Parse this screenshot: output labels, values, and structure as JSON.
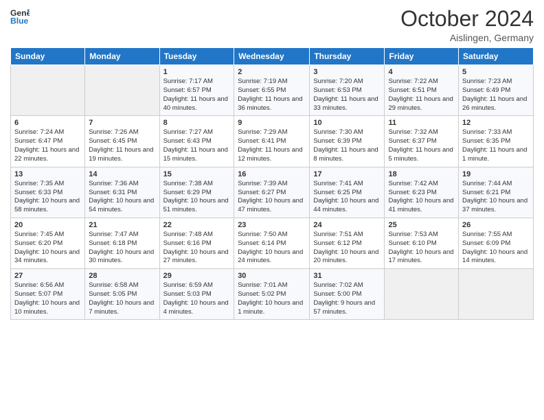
{
  "logo": {
    "line1": "General",
    "line2": "Blue"
  },
  "title": "October 2024",
  "location": "Aislingen, Germany",
  "weekdays": [
    "Sunday",
    "Monday",
    "Tuesday",
    "Wednesday",
    "Thursday",
    "Friday",
    "Saturday"
  ],
  "weeks": [
    [
      {
        "day": "",
        "sunrise": "",
        "sunset": "",
        "daylight": "",
        "empty": true
      },
      {
        "day": "",
        "sunrise": "",
        "sunset": "",
        "daylight": "",
        "empty": true
      },
      {
        "day": "1",
        "sunrise": "Sunrise: 7:17 AM",
        "sunset": "Sunset: 6:57 PM",
        "daylight": "Daylight: 11 hours and 40 minutes."
      },
      {
        "day": "2",
        "sunrise": "Sunrise: 7:19 AM",
        "sunset": "Sunset: 6:55 PM",
        "daylight": "Daylight: 11 hours and 36 minutes."
      },
      {
        "day": "3",
        "sunrise": "Sunrise: 7:20 AM",
        "sunset": "Sunset: 6:53 PM",
        "daylight": "Daylight: 11 hours and 33 minutes."
      },
      {
        "day": "4",
        "sunrise": "Sunrise: 7:22 AM",
        "sunset": "Sunset: 6:51 PM",
        "daylight": "Daylight: 11 hours and 29 minutes."
      },
      {
        "day": "5",
        "sunrise": "Sunrise: 7:23 AM",
        "sunset": "Sunset: 6:49 PM",
        "daylight": "Daylight: 11 hours and 26 minutes."
      }
    ],
    [
      {
        "day": "6",
        "sunrise": "Sunrise: 7:24 AM",
        "sunset": "Sunset: 6:47 PM",
        "daylight": "Daylight: 11 hours and 22 minutes."
      },
      {
        "day": "7",
        "sunrise": "Sunrise: 7:26 AM",
        "sunset": "Sunset: 6:45 PM",
        "daylight": "Daylight: 11 hours and 19 minutes."
      },
      {
        "day": "8",
        "sunrise": "Sunrise: 7:27 AM",
        "sunset": "Sunset: 6:43 PM",
        "daylight": "Daylight: 11 hours and 15 minutes."
      },
      {
        "day": "9",
        "sunrise": "Sunrise: 7:29 AM",
        "sunset": "Sunset: 6:41 PM",
        "daylight": "Daylight: 11 hours and 12 minutes."
      },
      {
        "day": "10",
        "sunrise": "Sunrise: 7:30 AM",
        "sunset": "Sunset: 6:39 PM",
        "daylight": "Daylight: 11 hours and 8 minutes."
      },
      {
        "day": "11",
        "sunrise": "Sunrise: 7:32 AM",
        "sunset": "Sunset: 6:37 PM",
        "daylight": "Daylight: 11 hours and 5 minutes."
      },
      {
        "day": "12",
        "sunrise": "Sunrise: 7:33 AM",
        "sunset": "Sunset: 6:35 PM",
        "daylight": "Daylight: 11 hours and 1 minute."
      }
    ],
    [
      {
        "day": "13",
        "sunrise": "Sunrise: 7:35 AM",
        "sunset": "Sunset: 6:33 PM",
        "daylight": "Daylight: 10 hours and 58 minutes."
      },
      {
        "day": "14",
        "sunrise": "Sunrise: 7:36 AM",
        "sunset": "Sunset: 6:31 PM",
        "daylight": "Daylight: 10 hours and 54 minutes."
      },
      {
        "day": "15",
        "sunrise": "Sunrise: 7:38 AM",
        "sunset": "Sunset: 6:29 PM",
        "daylight": "Daylight: 10 hours and 51 minutes."
      },
      {
        "day": "16",
        "sunrise": "Sunrise: 7:39 AM",
        "sunset": "Sunset: 6:27 PM",
        "daylight": "Daylight: 10 hours and 47 minutes."
      },
      {
        "day": "17",
        "sunrise": "Sunrise: 7:41 AM",
        "sunset": "Sunset: 6:25 PM",
        "daylight": "Daylight: 10 hours and 44 minutes."
      },
      {
        "day": "18",
        "sunrise": "Sunrise: 7:42 AM",
        "sunset": "Sunset: 6:23 PM",
        "daylight": "Daylight: 10 hours and 41 minutes."
      },
      {
        "day": "19",
        "sunrise": "Sunrise: 7:44 AM",
        "sunset": "Sunset: 6:21 PM",
        "daylight": "Daylight: 10 hours and 37 minutes."
      }
    ],
    [
      {
        "day": "20",
        "sunrise": "Sunrise: 7:45 AM",
        "sunset": "Sunset: 6:20 PM",
        "daylight": "Daylight: 10 hours and 34 minutes."
      },
      {
        "day": "21",
        "sunrise": "Sunrise: 7:47 AM",
        "sunset": "Sunset: 6:18 PM",
        "daylight": "Daylight: 10 hours and 30 minutes."
      },
      {
        "day": "22",
        "sunrise": "Sunrise: 7:48 AM",
        "sunset": "Sunset: 6:16 PM",
        "daylight": "Daylight: 10 hours and 27 minutes."
      },
      {
        "day": "23",
        "sunrise": "Sunrise: 7:50 AM",
        "sunset": "Sunset: 6:14 PM",
        "daylight": "Daylight: 10 hours and 24 minutes."
      },
      {
        "day": "24",
        "sunrise": "Sunrise: 7:51 AM",
        "sunset": "Sunset: 6:12 PM",
        "daylight": "Daylight: 10 hours and 20 minutes."
      },
      {
        "day": "25",
        "sunrise": "Sunrise: 7:53 AM",
        "sunset": "Sunset: 6:10 PM",
        "daylight": "Daylight: 10 hours and 17 minutes."
      },
      {
        "day": "26",
        "sunrise": "Sunrise: 7:55 AM",
        "sunset": "Sunset: 6:09 PM",
        "daylight": "Daylight: 10 hours and 14 minutes."
      }
    ],
    [
      {
        "day": "27",
        "sunrise": "Sunrise: 6:56 AM",
        "sunset": "Sunset: 5:07 PM",
        "daylight": "Daylight: 10 hours and 10 minutes."
      },
      {
        "day": "28",
        "sunrise": "Sunrise: 6:58 AM",
        "sunset": "Sunset: 5:05 PM",
        "daylight": "Daylight: 10 hours and 7 minutes."
      },
      {
        "day": "29",
        "sunrise": "Sunrise: 6:59 AM",
        "sunset": "Sunset: 5:03 PM",
        "daylight": "Daylight: 10 hours and 4 minutes."
      },
      {
        "day": "30",
        "sunrise": "Sunrise: 7:01 AM",
        "sunset": "Sunset: 5:02 PM",
        "daylight": "Daylight: 10 hours and 1 minute."
      },
      {
        "day": "31",
        "sunrise": "Sunrise: 7:02 AM",
        "sunset": "Sunset: 5:00 PM",
        "daylight": "Daylight: 9 hours and 57 minutes."
      },
      {
        "day": "",
        "sunrise": "",
        "sunset": "",
        "daylight": "",
        "empty": true
      },
      {
        "day": "",
        "sunrise": "",
        "sunset": "",
        "daylight": "",
        "empty": true
      }
    ]
  ]
}
